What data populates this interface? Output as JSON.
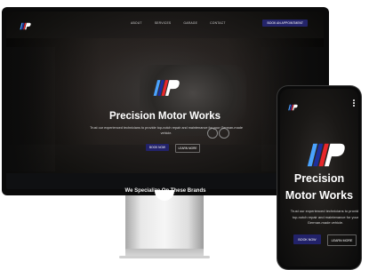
{
  "desktop": {
    "nav": {
      "links": [
        "ABOUT",
        "SERVICES",
        "GARAGE",
        "CONTACT"
      ],
      "cta": "BOOK AN APPOINTMENT"
    },
    "hero": {
      "title": "Precision Motor Works",
      "subtitle": "Trust our experienced technicians to provide top-notch repair and maintenance for your German-made vehicle.",
      "book_label": "BOOK NOW",
      "learn_label": "LEARN MORE"
    },
    "section_heading": "We Specialize On These Brands"
  },
  "mobile": {
    "hero": {
      "title_line1": "Precision",
      "title_line2": "Motor Works",
      "subtitle": "Trust our experienced technicians to provide top-notch repair and maintenance for your German-made vehicle.",
      "book_label": "BOOK NOW",
      "learn_label": "LEARN MORE"
    }
  },
  "brand_colors": {
    "stripe_light_blue": "#4aa3ff",
    "stripe_dark_blue": "#1d2f9e",
    "stripe_red": "#e8262a",
    "button_navy": "#22226a"
  },
  "icons": [
    "pmw-logo-icon",
    "menu-icon"
  ]
}
